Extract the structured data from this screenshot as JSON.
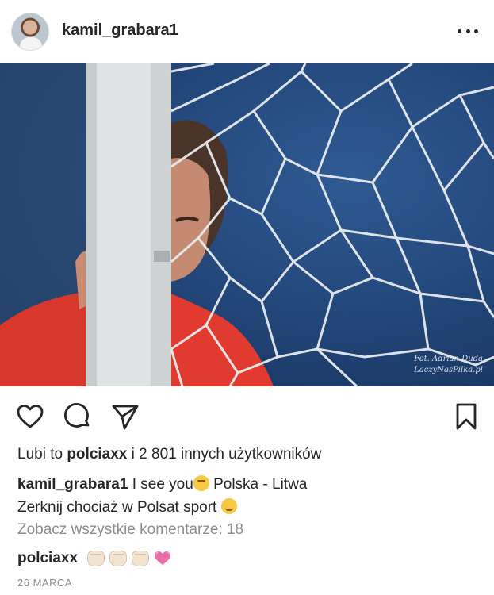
{
  "post": {
    "username": "kamil_grabara1",
    "photo_credit_line1": "Fot. Adrian Duda",
    "photo_credit_line2": "LaczyNasPilka.pl",
    "likes_prefix": "Lubi to",
    "likes_user": "polciaxx",
    "likes_suffix": "i 2 801 innych użytkowników",
    "caption_user": "kamil_grabara1",
    "caption_text_1": "I see you",
    "caption_text_2": "Polska - Litwa",
    "caption_text_3": "Zerknij chociaż w Polsat sport",
    "view_all_comments": "Zobacz wszystkie komentarze: 18",
    "comment_user": "polciaxx",
    "date": "26 MARCA"
  },
  "icons": {
    "more": "more-options-icon",
    "like": "heart-icon",
    "comment": "comment-icon",
    "share": "send-icon",
    "save": "bookmark-icon"
  },
  "colors": {
    "text": "#262626",
    "muted": "#8e8e8e",
    "net": "#e9ecef",
    "shirt": "#e23a2c"
  }
}
